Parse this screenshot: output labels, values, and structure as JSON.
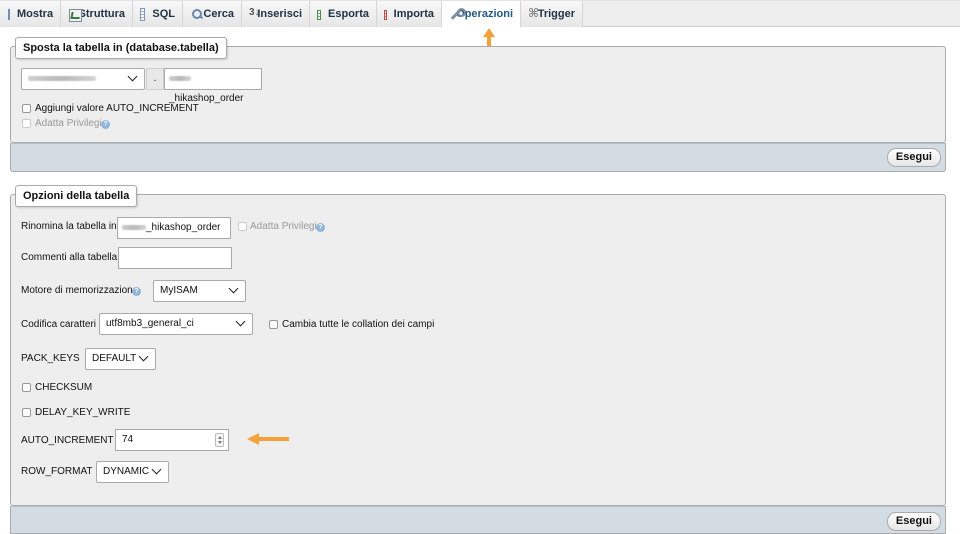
{
  "tabs": [
    {
      "label": "Mostra",
      "icon": "browse-table-icon"
    },
    {
      "label": "Struttura",
      "icon": "structure-icon"
    },
    {
      "label": "SQL",
      "icon": "sql-icon"
    },
    {
      "label": "Cerca",
      "icon": "search-icon"
    },
    {
      "label": "Inserisci",
      "icon": "insert-icon"
    },
    {
      "label": "Esporta",
      "icon": "export-icon"
    },
    {
      "label": "Importa",
      "icon": "import-icon"
    },
    {
      "label": "Operazioni",
      "icon": "wrench-icon",
      "active": true
    },
    {
      "label": "Trigger",
      "icon": "trigger-icon"
    }
  ],
  "move_table": {
    "legend": "Sposta la tabella in (database.tabella)",
    "separator": ".",
    "table_name": "_hikashop_order",
    "auto_increment_label": "Aggiungi valore AUTO_INCREMENT",
    "adjust_privileges_label": "Adatta Privilegi",
    "go_label": "Esegui"
  },
  "table_options": {
    "legend": "Opzioni della tabella",
    "rename_label": "Rinomina la tabella in",
    "rename_value": "_hikashop_order",
    "adjust_privileges_label": "Adatta Privilegi",
    "comments_label": "Commenti alla tabella",
    "comments_value": "",
    "engine_label": "Motore di memorizzazione",
    "engine_value": "MyISAM",
    "collation_label": "Codifica caratteri",
    "collation_value": "utf8mb3_general_ci",
    "change_all_collations_label": "Cambia tutte le collation dei campi",
    "pack_keys_label": "PACK_KEYS",
    "pack_keys_value": "DEFAULT",
    "checksum_label": "CHECKSUM",
    "delay_key_write_label": "DELAY_KEY_WRITE",
    "auto_increment_label": "AUTO_INCREMENT",
    "auto_increment_value": "74",
    "row_format_label": "ROW_FORMAT",
    "row_format_value": "DYNAMIC",
    "go_label": "Esegui"
  },
  "colors": {
    "annotation_arrow": "#f5a13a",
    "footer_bar": "#d3dce3",
    "panel_bg": "#eeeeee"
  }
}
